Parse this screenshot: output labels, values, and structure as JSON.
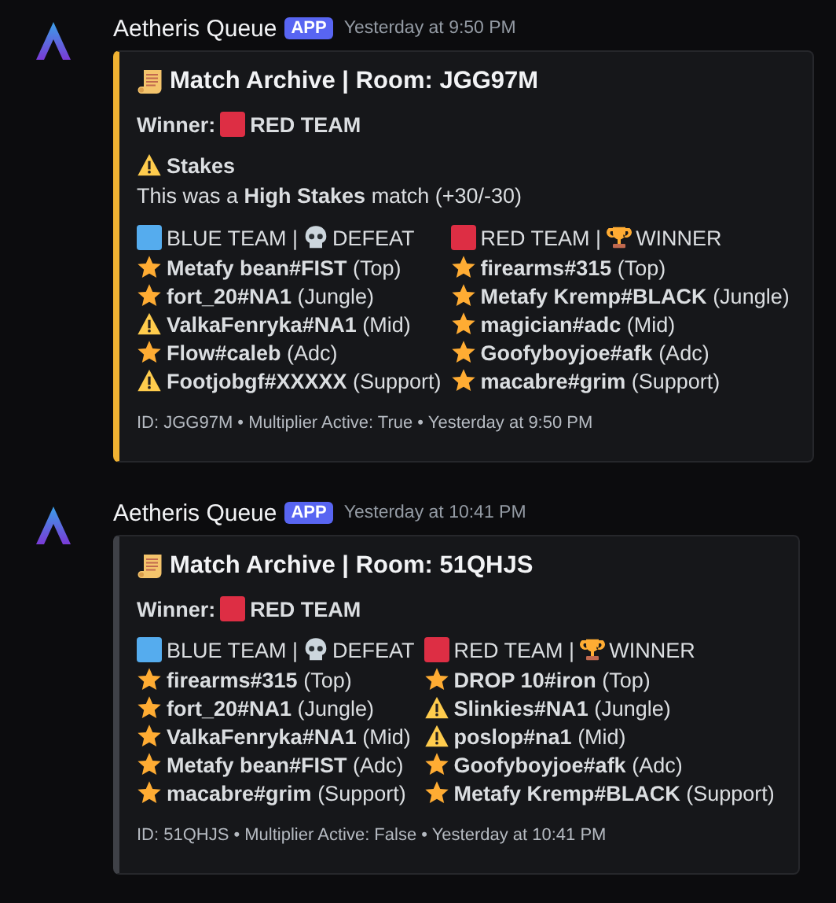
{
  "messages": [
    {
      "author": "Aetheris Queue",
      "badge": "APP",
      "timestamp": "Yesterday at 9:50 PM",
      "embed": {
        "color": "#f0b232",
        "title": "Match Archive | Room: JGG97M",
        "winner": {
          "label": "Winner:",
          "team": "RED TEAM",
          "color": "#dd2e44"
        },
        "stakes": {
          "title": "Stakes",
          "text": "This was a **High Stakes** match (+30/-30)"
        },
        "teams": [
          {
            "label": "BLUE TEAM |",
            "result": "DEFEAT",
            "kind": "defeat",
            "color": "#55acee",
            "players": [
              {
                "kind": "star",
                "text": "**Metafy bean#FIST** (Top)"
              },
              {
                "kind": "star",
                "text": "**fort_20#NA1** (Jungle)"
              },
              {
                "kind": "warning",
                "text": "**ValkaFenryka#NA1** (Mid)"
              },
              {
                "kind": "star",
                "text": "**Flow#caleb** (Adc)"
              },
              {
                "kind": "warning",
                "text": "**Footjobgf#XXXXX** (Support)"
              }
            ]
          },
          {
            "label": "RED TEAM |",
            "result": "WINNER",
            "kind": "winner",
            "color": "#dd2e44",
            "players": [
              {
                "kind": "star",
                "text": "**firearms#315** (Top)"
              },
              {
                "kind": "star",
                "text": "**Metafy Kremp#BLACK** (Jungle)"
              },
              {
                "kind": "star",
                "text": "**magician#adc** (Mid)"
              },
              {
                "kind": "star",
                "text": "**Goofyboyjoe#afk** (Adc)"
              },
              {
                "kind": "star",
                "text": "**macabre#grim** (Support)"
              }
            ]
          }
        ],
        "footer": "ID: JGG97M • Multiplier Active: True • Yesterday at 9:50 PM"
      }
    },
    {
      "author": "Aetheris Queue",
      "badge": "APP",
      "timestamp": "Yesterday at 10:41 PM",
      "embed": {
        "color": "#3f4147",
        "title": "Match Archive | Room: 51QHJS",
        "winner": {
          "label": "Winner:",
          "team": "RED TEAM",
          "color": "#dd2e44"
        },
        "teams": [
          {
            "label": "BLUE TEAM |",
            "result": "DEFEAT",
            "kind": "defeat",
            "color": "#55acee",
            "players": [
              {
                "kind": "star",
                "text": "**firearms#315** (Top)"
              },
              {
                "kind": "star",
                "text": "**fort_20#NA1** (Jungle)"
              },
              {
                "kind": "star",
                "text": "**ValkaFenryka#NA1** (Mid)"
              },
              {
                "kind": "star",
                "text": "**Metafy bean#FIST** (Adc)"
              },
              {
                "kind": "star",
                "text": "**macabre#grim** (Support)"
              }
            ]
          },
          {
            "label": "RED TEAM |",
            "result": "WINNER",
            "kind": "winner",
            "color": "#dd2e44",
            "players": [
              {
                "kind": "star",
                "text": "**DROP 10#iron** (Top)"
              },
              {
                "kind": "warning",
                "text": "**Slinkies#NA1** (Jungle)"
              },
              {
                "kind": "warning",
                "text": "**poslop#na1** (Mid)"
              },
              {
                "kind": "star",
                "text": "**Goofyboyjoe#afk** (Adc)"
              },
              {
                "kind": "star",
                "text": "**Metafy Kremp#BLACK** (Support)"
              }
            ]
          }
        ],
        "footer": "ID: 51QHJS • Multiplier Active: False • Yesterday at 10:41 PM"
      }
    }
  ]
}
